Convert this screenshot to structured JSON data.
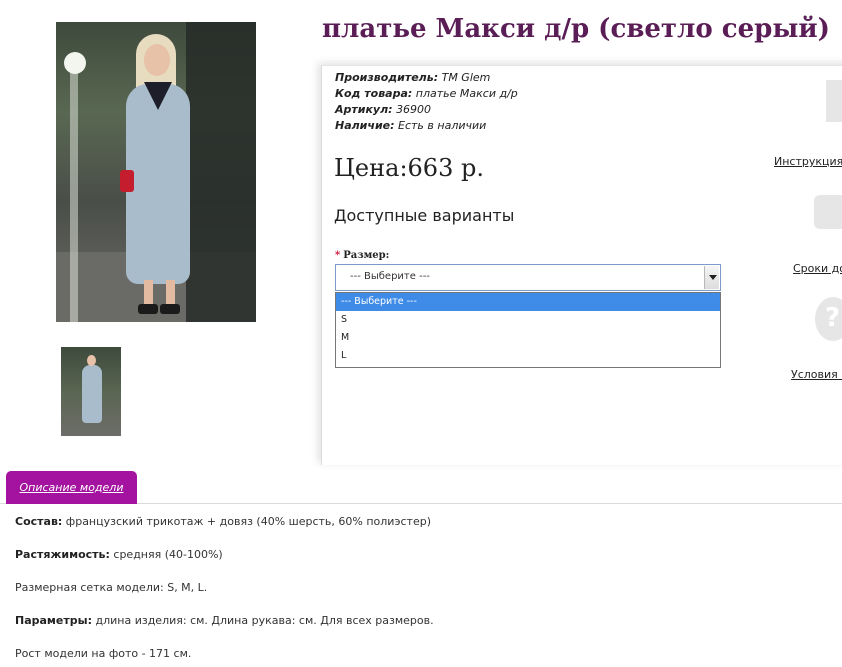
{
  "product": {
    "title": "платье Макси д/р (светло серый)"
  },
  "meta": [
    {
      "key": "Производитель:",
      "value": "ТМ Glem"
    },
    {
      "key": "Код товара:",
      "value": "платье Макси д/р"
    },
    {
      "key": "Артикул:",
      "value": "36900"
    },
    {
      "key": "Наличие:",
      "value": "Есть в наличии"
    }
  ],
  "price": "Цена:663 р.",
  "variants": {
    "heading": "Доступные варианты",
    "required_mark": "*",
    "size_label": "Размер:",
    "selected": "--- Выберите ---",
    "options": [
      "--- Выберите ---",
      "S",
      "M",
      "L"
    ]
  },
  "side_links": {
    "instructions": "Инструкция по",
    "delivery": "Сроки дос",
    "conditions": "Условия п"
  },
  "tabs": {
    "description": "Описание модели"
  },
  "description": [
    {
      "key": "Состав:",
      "value": " французский трикотаж + довяз (40% шерсть, 60% полиэстер)"
    },
    {
      "key": "Растяжимость:",
      "value": " средняя (40-100%)"
    },
    {
      "key": "",
      "value": "Размерная сетка модели: S, M, L."
    },
    {
      "key": "Параметры:",
      "value": " длина изделия: см. Длина рукава: см. Для всех размеров."
    },
    {
      "key": "",
      "value": "Рост модели на фото - 171 см."
    }
  ],
  "colors": {
    "title": "#5a1d56",
    "tab": "#a3139f",
    "selected_option": "#3f8ce8",
    "required": "#c8102e"
  }
}
